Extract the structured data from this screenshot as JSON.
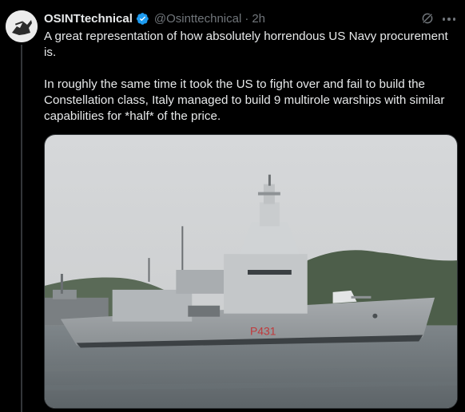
{
  "author": {
    "display_name": "OSINTtechnical",
    "handle": "@Osinttechnical",
    "separator": "·",
    "time": "2h",
    "verified": true,
    "verified_color": "#1d9bf0"
  },
  "tweet": {
    "text": "A great representation of how absolutely horrendous US Navy procurement is.\n\nIn roughly the same time it took the US to fight over and fail to build the Constellation class, Italy managed to build 9 multirole warships with similar capabilities for *half* of the price."
  },
  "media": {
    "hull_number": "P431"
  },
  "icons": {
    "grok": "grok-icon",
    "more": "more-options-icon",
    "verified": "verified-badge-icon"
  },
  "colors": {
    "background": "#000000",
    "text": "#e7e9ea",
    "secondary_text": "#71767b",
    "hull_number": "#c0393b"
  }
}
